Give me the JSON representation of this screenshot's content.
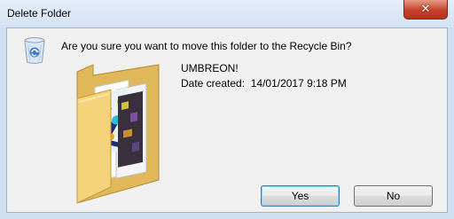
{
  "window": {
    "title": "Delete Folder",
    "close_glyph": "✕"
  },
  "dialog": {
    "question": "Are you sure you want to move this folder to the Recycle Bin?",
    "icon": "recycle-bin-icon",
    "item": {
      "icon": "folder-icon",
      "name": "UMBREON!",
      "date_label": "Date created:",
      "date_value": "14/01/2017 9:18 PM"
    }
  },
  "buttons": {
    "yes_label": "Yes",
    "no_label": "No"
  },
  "colors": {
    "titlebar": "#d3e2f3",
    "client": "#f0f0f0",
    "close": "#c6412a",
    "default_button_border": "#3c7fb1"
  }
}
